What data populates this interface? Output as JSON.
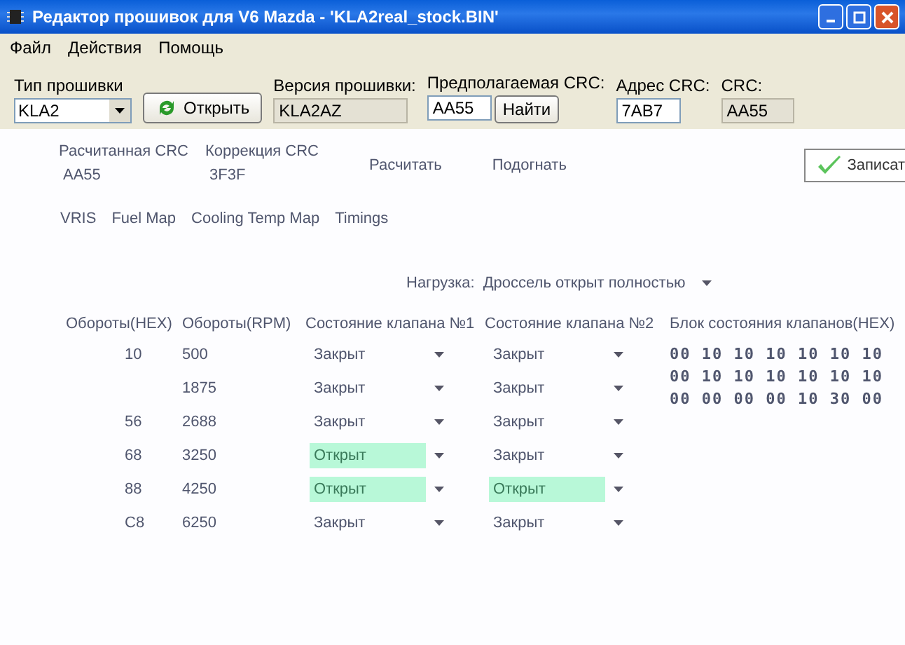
{
  "window": {
    "title": "Редактор прошивок для V6 Mazda - 'KLA2real_stock.BIN'"
  },
  "menu": [
    "Файл",
    "Действия",
    "Помощь"
  ],
  "toolbar": {
    "firmware_type": {
      "label": "Тип прошивки",
      "value": "KLA2"
    },
    "open_button": "Открыть",
    "version": {
      "label": "Версия прошивки:",
      "value": "KLA2AZ"
    },
    "expected_crc": {
      "label": "Предполагаемая CRC:",
      "value": "AA55"
    },
    "find_button": "Найти",
    "crc_address": {
      "label": "Адрес CRC:",
      "value": "7AB7"
    },
    "crc": {
      "label": "CRC:",
      "value": "AA55"
    }
  },
  "crc_panel": {
    "calculated": {
      "label": "Расчитанная CRC",
      "value": "AA55"
    },
    "correction": {
      "label": "Коррекция CRC",
      "value": "3F3F"
    },
    "calc_button": "Расчитать",
    "fit_button": "Подогнать",
    "write_button": "Записат"
  },
  "tabs": [
    "VRIS",
    "Fuel Map",
    "Cooling Temp Map",
    "Timings"
  ],
  "load": {
    "label": "Нагрузка:",
    "value": "Дроссель открыт полностью"
  },
  "table": {
    "columns": [
      "Обороты(HEX)",
      "Обороты(RPM)",
      "Состояние клапана №1",
      "Состояние клапана №2"
    ],
    "rows": [
      {
        "hex": "10",
        "rpm": "500",
        "valve1": {
          "text": "Закрыт",
          "open": false
        },
        "valve2": {
          "text": "Закрыт",
          "open": false
        }
      },
      {
        "rpm": "1875",
        "valve1": {
          "text": "Закрыт",
          "open": false
        },
        "valve2": {
          "text": "Закрыт",
          "open": false
        }
      },
      {
        "hex": "56",
        "rpm": "2688",
        "valve1": {
          "text": "Закрыт",
          "open": false
        },
        "valve2": {
          "text": "Закрыт",
          "open": false
        }
      },
      {
        "hex": "68",
        "rpm": "3250",
        "valve1": {
          "text": "Открыт",
          "open": true
        },
        "valve2": {
          "text": "Закрыт",
          "open": false
        }
      },
      {
        "hex": "88",
        "rpm": "4250",
        "valve1": {
          "text": "Открыт",
          "open": true
        },
        "valve2": {
          "text": "Открыт",
          "open": true
        }
      },
      {
        "hex": "C8",
        "rpm": "6250",
        "valve1": {
          "text": "Закрыт",
          "open": false
        },
        "valve2": {
          "text": "Закрыт",
          "open": false
        }
      }
    ]
  },
  "valve_block": {
    "title": "Блок состояния клапанов(HEX)",
    "lines": [
      "00 10 10 10 10 10 10",
      "00 10 10 10 10 10 10",
      "00 00 00 00 10 30 00"
    ]
  }
}
